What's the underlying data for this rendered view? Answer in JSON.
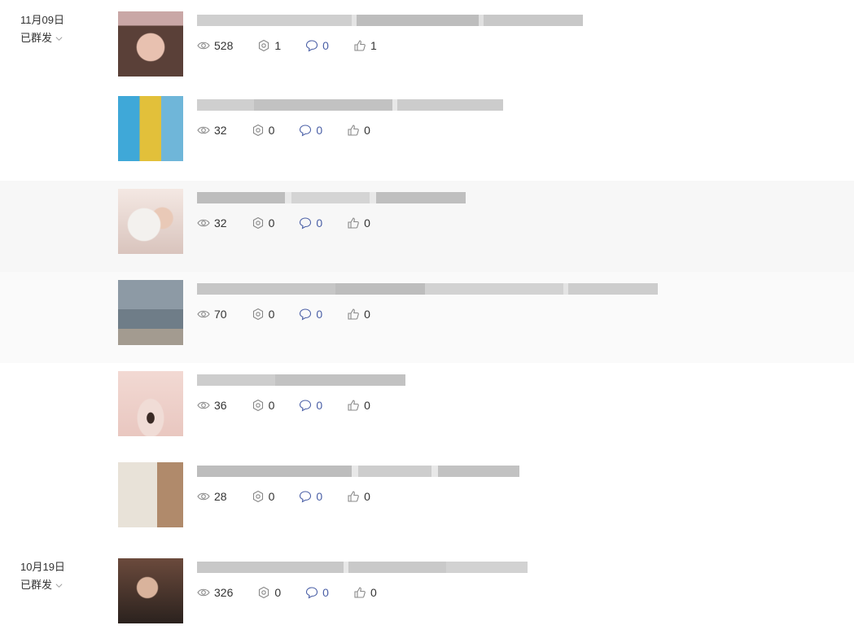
{
  "groups": [
    {
      "date": "11月09日",
      "status": "已群发"
    },
    {
      "date": "10月19日",
      "status": "已群发"
    }
  ],
  "rows": [
    {
      "views": "528",
      "shares": "1",
      "comments": "0",
      "likes": "1",
      "thumb": "portrait-pink-hat"
    },
    {
      "views": "32",
      "shares": "0",
      "comments": "0",
      "likes": "0",
      "thumb": "books-covers"
    },
    {
      "views": "32",
      "shares": "0",
      "comments": "0",
      "likes": "0",
      "thumb": "portrait-bunny"
    },
    {
      "views": "70",
      "shares": "0",
      "comments": "0",
      "likes": "0",
      "thumb": "beach-children"
    },
    {
      "views": "36",
      "shares": "0",
      "comments": "0",
      "likes": "0",
      "thumb": "eye-closeup"
    },
    {
      "views": "28",
      "shares": "0",
      "comments": "0",
      "likes": "0",
      "thumb": "pants-legs"
    },
    {
      "views": "326",
      "shares": "0",
      "comments": "0",
      "likes": "0",
      "thumb": "portrait-dark"
    }
  ],
  "colors": {
    "accent": "#4a5fa6",
    "icon": "#888888",
    "band": "#f7f7f7"
  }
}
